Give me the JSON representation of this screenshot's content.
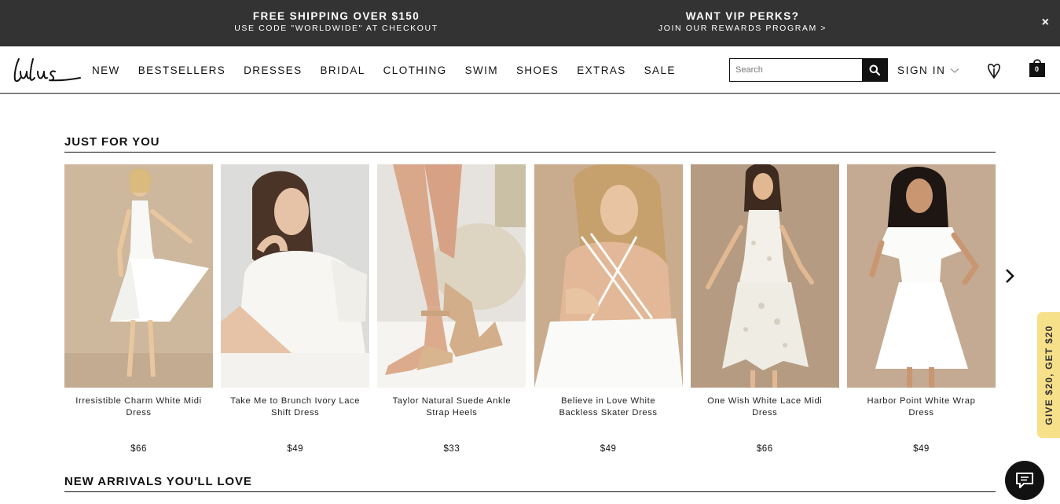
{
  "promo": {
    "left_heading": "FREE SHIPPING OVER $150",
    "left_sub": "USE CODE \"WORLDWIDE\" AT CHECKOUT",
    "right_heading": "WANT VIP PERKS?",
    "right_sub": "JOIN OUR REWARDS PROGRAM >",
    "close_label": "×"
  },
  "header": {
    "logo_alt": "Lulus",
    "nav": [
      "NEW",
      "BESTSELLERS",
      "DRESSES",
      "BRIDAL",
      "CLOTHING",
      "SWIM",
      "SHOES",
      "EXTRAS",
      "SALE"
    ],
    "search_placeholder": "Search",
    "sign_in": "SIGN IN",
    "bag_count": "0"
  },
  "just_for_you": {
    "title": "JUST FOR YOU",
    "products": [
      {
        "name": "Irresistible Charm White Midi Dress",
        "price": "$66"
      },
      {
        "name": "Take Me to Brunch Ivory Lace Shift Dress",
        "price": "$49"
      },
      {
        "name": "Taylor Natural Suede Ankle Strap Heels",
        "price": "$33"
      },
      {
        "name": "Believe in Love White Backless Skater Dress",
        "price": "$49"
      },
      {
        "name": "One Wish White Lace Midi Dress",
        "price": "$66"
      },
      {
        "name": "Harbor Point White Wrap Dress",
        "price": "$49"
      }
    ]
  },
  "new_arrivals": {
    "title": "NEW ARRIVALS YOU'LL LOVE"
  },
  "give_tab": "GIVE $20, GET $20",
  "icons": {
    "search": "search-icon",
    "heart": "heart-icon",
    "bag": "shopping-bag-icon",
    "next": "chevron-right-icon",
    "chat": "chat-icon",
    "chevron": "chevron-down-icon"
  },
  "colors": {
    "promo_bg": "#333333",
    "accent_tab": "#f7e08a",
    "text": "#111111"
  }
}
